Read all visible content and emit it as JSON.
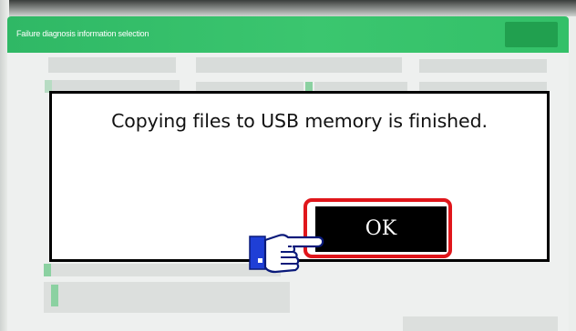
{
  "window": {
    "title": "Failure diagnosis information selection"
  },
  "dialog": {
    "message": "Copying files to USB memory is finished.",
    "ok_label": "OK"
  },
  "icons": {
    "pointer": "pointing-hand-icon"
  },
  "colors": {
    "titlebar": "#33c068",
    "highlight": "#e0161b",
    "ok_button": "#000000"
  }
}
